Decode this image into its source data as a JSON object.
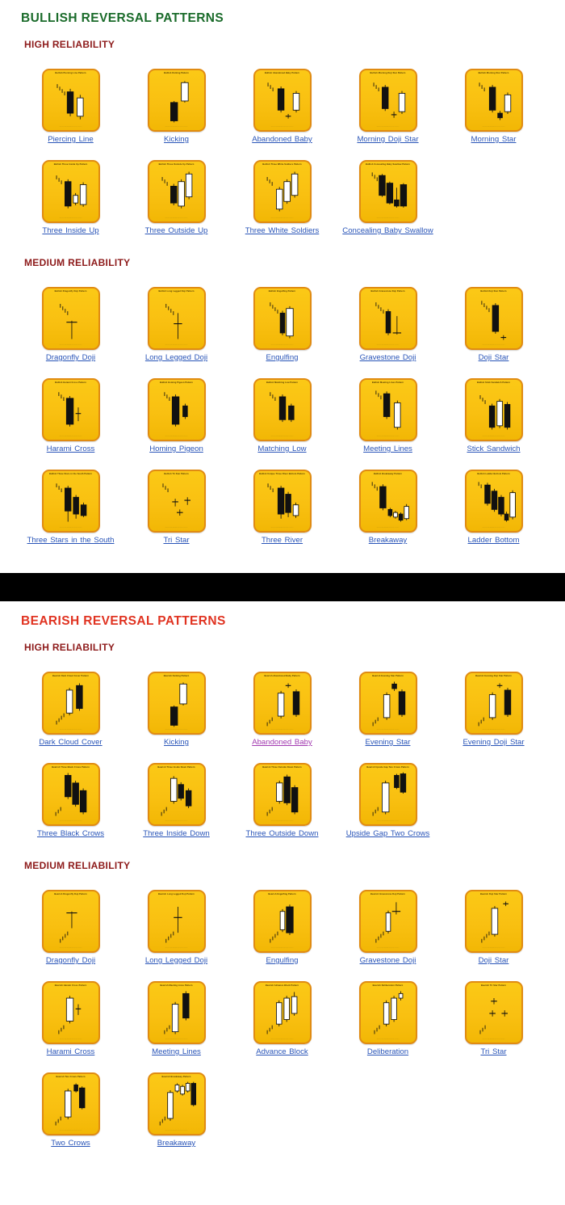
{
  "sections": [
    {
      "id": "bullish",
      "title": "BULLISH REVERSAL PATTERNS",
      "title_color": "#1a6b2a",
      "groups": [
        {
          "id": "bullish-high",
          "heading": "HIGH RELIABILITY",
          "heading_color": "#8d1a1a",
          "items": [
            {
              "label": "Piercing Line",
              "caption": "Bullish Piercing Line Pattern",
              "link_state": "unvisited"
            },
            {
              "label": "Kicking",
              "caption": "Bullish Kicking Pattern",
              "link_state": "unvisited"
            },
            {
              "label": "Abandoned Baby",
              "caption": "Bullish Abandoned Baby Pattern",
              "link_state": "unvisited"
            },
            {
              "label": "Morning Doji Star",
              "caption": "Bullish Morning Doji Star Pattern",
              "link_state": "unvisited"
            },
            {
              "label": "Morning Star",
              "caption": "Bullish Morning Star Pattern",
              "link_state": "unvisited"
            },
            {
              "label": "Three Inside Up",
              "caption": "Bullish Three Inside Up Pattern",
              "link_state": "unvisited"
            },
            {
              "label": "Three Outside Up",
              "caption": "Bullish Three Outside Up Pattern",
              "link_state": "unvisited"
            },
            {
              "label": "Three White Soldiers",
              "caption": "Bullish Three White Soldiers Pattern",
              "link_state": "unvisited"
            },
            {
              "label": "Concealing Baby Swallow",
              "caption": "Bullish Concealing Baby Swallow Pattern",
              "link_state": "unvisited"
            }
          ]
        },
        {
          "id": "bullish-medium",
          "heading": "MEDIUM RELIABILITY",
          "heading_color": "#8d1a1a",
          "items": [
            {
              "label": "Dragonfly Doji",
              "caption": "Bullish Dragonfly Doji Pattern",
              "link_state": "unvisited"
            },
            {
              "label": "Long Legged Doji",
              "caption": "Bullish Long Legged Doji Pattern",
              "link_state": "unvisited"
            },
            {
              "label": "Engulfing",
              "caption": "Bullish Engulfing Pattern",
              "link_state": "unvisited"
            },
            {
              "label": "Gravestone Doji",
              "caption": "Bullish Gravestone Doji Pattern",
              "link_state": "unvisited"
            },
            {
              "label": "Doji Star",
              "caption": "Bullish Doji Star Pattern",
              "link_state": "unvisited"
            },
            {
              "label": "Harami Cross",
              "caption": "Bullish Harami Cross Pattern",
              "link_state": "unvisited"
            },
            {
              "label": "Homing Pigeon",
              "caption": "Bullish Homing Pigeon Pattern",
              "link_state": "unvisited"
            },
            {
              "label": "Matching Low",
              "caption": "Bullish Matching Low Pattern",
              "link_state": "unvisited"
            },
            {
              "label": "Meeting Lines",
              "caption": "Bullish Meeting Lines Pattern",
              "link_state": "unvisited"
            },
            {
              "label": "Stick Sandwich",
              "caption": "Bullish Stick Sandwich Pattern",
              "link_state": "unvisited"
            },
            {
              "label": "Three Stars in the South",
              "caption": "Bullish Three Stars in the South Pattern",
              "link_state": "unvisited"
            },
            {
              "label": "Tri Star",
              "caption": "Bullish Tri Star Pattern",
              "link_state": "unvisited"
            },
            {
              "label": "Three River",
              "caption": "Bullish Unique Three River Bottom Pattern",
              "link_state": "unvisited"
            },
            {
              "label": "Breakaway",
              "caption": "Bullish Breakaway Pattern",
              "link_state": "unvisited"
            },
            {
              "label": "Ladder Bottom",
              "caption": "Bullish Ladder Bottom Pattern",
              "link_state": "unvisited"
            }
          ]
        }
      ]
    },
    {
      "id": "bearish",
      "title": "BEARISH REVERSAL PATTERNS",
      "title_color": "#e03321",
      "groups": [
        {
          "id": "bearish-high",
          "heading": "HIGH RELIABILITY",
          "heading_color": "#8d1a1a",
          "items": [
            {
              "label": "Dark Cloud Cover",
              "caption": "Bearish Dark Cloud Cover Pattern",
              "link_state": "unvisited"
            },
            {
              "label": "Kicking",
              "caption": "Bearish Kicking Pattern",
              "link_state": "unvisited"
            },
            {
              "label": "Abandoned Baby",
              "caption": "Bearish Abandoned Baby Pattern",
              "link_state": "visited"
            },
            {
              "label": "Evening Star",
              "caption": "Bearish Evening Star Pattern",
              "link_state": "unvisited"
            },
            {
              "label": "Evening Doji Star",
              "caption": "Bearish Evening Doji Star Pattern",
              "link_state": "unvisited"
            },
            {
              "label": "Three Black Crows",
              "caption": "Bearish Three Black Crows Pattern",
              "link_state": "unvisited"
            },
            {
              "label": "Three Inside Down",
              "caption": "Bearish Three Inside Down Pattern",
              "link_state": "unvisited"
            },
            {
              "label": "Three Outside Down",
              "caption": "Bearish Three Outside Down Pattern",
              "link_state": "unvisited"
            },
            {
              "label": "Upside Gap Two Crows",
              "caption": "Bearish Upside Gap Two Crows Pattern",
              "link_state": "unvisited"
            }
          ]
        },
        {
          "id": "bearish-medium",
          "heading": "MEDIUM RELIABILITY",
          "heading_color": "#8d1a1a",
          "items": [
            {
              "label": "Dragonfly Doji",
              "caption": "Bearish Dragonfly Doji Pattern",
              "link_state": "unvisited"
            },
            {
              "label": "Long Legged Doji",
              "caption": "Bearish Long Legged Doji Pattern",
              "link_state": "unvisited"
            },
            {
              "label": "Engulfing",
              "caption": "Bearish Engulfing Pattern",
              "link_state": "unvisited"
            },
            {
              "label": "Gravestone Doji",
              "caption": "Bearish Gravestone Doji Pattern",
              "link_state": "unvisited"
            },
            {
              "label": "Doji Star",
              "caption": "Bearish Doji Star Pattern",
              "link_state": "unvisited"
            },
            {
              "label": "Harami Cross",
              "caption": "Bearish Harami Cross Pattern",
              "link_state": "unvisited"
            },
            {
              "label": "Meeting Lines",
              "caption": "Bearish Meeting Lines Pattern",
              "link_state": "unvisited"
            },
            {
              "label": "Advance Block",
              "caption": "Bearish Advance Block Pattern",
              "link_state": "unvisited"
            },
            {
              "label": "Deliberation",
              "caption": "Bearish Deliberation Pattern",
              "link_state": "unvisited"
            },
            {
              "label": "Tri Star",
              "caption": "Bearish Tri Star Pattern",
              "link_state": "unvisited"
            },
            {
              "label": "Two Crows",
              "caption": "Bearish Two Crows Pattern",
              "link_state": "unvisited"
            },
            {
              "label": "Breakaway",
              "caption": "Bearish Breakaway Pattern",
              "link_state": "unvisited"
            }
          ]
        }
      ]
    }
  ],
  "thumbnail": {
    "footer_text": "www.candlestickforum.com",
    "background_color": "#f9c011",
    "border_color": "#e08b12",
    "body_black": "#111111",
    "body_white": "#ffffff"
  },
  "divider": {
    "color": "#000000"
  },
  "link_colors": {
    "unvisited": "#2a55b8",
    "visited": "#a23bb0"
  }
}
